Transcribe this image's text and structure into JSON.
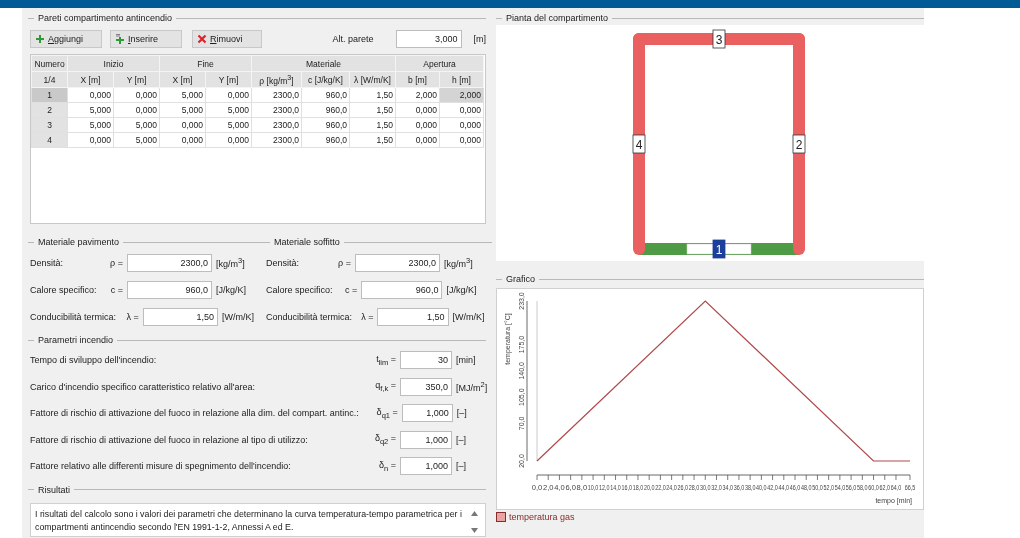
{
  "walls_section": {
    "title": "Pareti compartimento antincendio",
    "buttons": [
      {
        "label": "Aggiungi",
        "kind": "add"
      },
      {
        "label": "Inserire",
        "kind": "insert"
      },
      {
        "label": "Rimuovi",
        "kind": "remove"
      }
    ],
    "height_field": {
      "label": "Alt. parete",
      "value": "3,000",
      "unit": "[m]"
    }
  },
  "table": {
    "group_headers": [
      "Numero",
      "Inizio",
      "Fine",
      "Materiale",
      "Apertura"
    ],
    "columns": [
      "1/4",
      "X [m]",
      "Y [m]",
      "X [m]",
      "Y [m]",
      "ρ [kg/m$^{3}$]",
      "c [J/kg/K]",
      "λ [W/m/K]",
      "b [m]",
      "h [m]"
    ],
    "rows": [
      {
        "selected": true,
        "cells": [
          "1",
          "0,000",
          "0,000",
          "5,000",
          "0,000",
          "2300,0",
          "960,0",
          "1,50",
          "2,000",
          "2,000"
        ]
      },
      {
        "selected": false,
        "cells": [
          "2",
          "5,000",
          "0,000",
          "5,000",
          "5,000",
          "2300,0",
          "960,0",
          "1,50",
          "0,000",
          "0,000"
        ]
      },
      {
        "selected": false,
        "cells": [
          "3",
          "5,000",
          "5,000",
          "0,000",
          "5,000",
          "2300,0",
          "960,0",
          "1,50",
          "0,000",
          "0,000"
        ]
      },
      {
        "selected": false,
        "cells": [
          "4",
          "0,000",
          "5,000",
          "0,000",
          "0,000",
          "2300,0",
          "960,0",
          "1,50",
          "0,000",
          "0,000"
        ]
      }
    ]
  },
  "floor_material": {
    "title": "Materiale pavimento",
    "fields": [
      {
        "label": "Densità:",
        "symbol": "ρ =",
        "value": "2300,0",
        "unit": "[kg/m$^{3}$]"
      },
      {
        "label": "Calore specifico:",
        "symbol": "c =",
        "value": "960,0",
        "unit": "[J/kg/K]"
      },
      {
        "label": "Conducibilità termica:",
        "symbol": "λ =",
        "value": "1,50",
        "unit": "[W/m/K]"
      }
    ]
  },
  "ceiling_material": {
    "title": "Materiale soffitto",
    "fields": [
      {
        "label": "Densità:",
        "symbol": "ρ =",
        "value": "2300,0",
        "unit": "[kg/m$^{3}$]"
      },
      {
        "label": "Calore specifico:",
        "symbol": "c =",
        "value": "960,0",
        "unit": "[J/kg/K]"
      },
      {
        "label": "Conducibilità termica:",
        "symbol": "λ =",
        "value": "1,50",
        "unit": "[W/m/K]"
      }
    ]
  },
  "fire_parameters": {
    "title": "Parametri incendio",
    "fields": [
      {
        "label": "Tempo di sviluppo dell'incendio:",
        "symbol": "t$_{lim}$ =",
        "value": "30",
        "unit": "[min]"
      },
      {
        "label": "Carico d'incendio specifico caratteristico relativo all'area:",
        "symbol": "q$_{f,k}$ =",
        "value": "350,0",
        "unit": "[MJ/m$^{2}$]"
      },
      {
        "label": "Fattore di rischio di attivazione del fuoco in relazione alla dim. del compart. antinc.:",
        "symbol": "δ$_{q1}$ =",
        "value": "1,000",
        "unit": "[–]"
      },
      {
        "label": "Fattore di rischio di attivazione del fuoco in relazione al tipo di utilizzo:",
        "symbol": "δ$_{q2}$ =",
        "value": "1,000",
        "unit": "[–]"
      },
      {
        "label": "Fattore relativo alle differenti misure di spegnimento dell'incendio:",
        "symbol": "δ$_{n}$ =",
        "value": "1,000",
        "unit": "[–]"
      }
    ]
  },
  "results": {
    "title": "Risultati",
    "text": "I risultati del calcolo sono i valori dei parametri che determinano la curva temperatura-tempo parametrica per i compartmenti antincendio secondo l'EN 1991-1-2, Annessi A ed E."
  },
  "plan": {
    "title": "Pianta del compartimento",
    "walls": [
      {
        "label": "1",
        "selected": true
      },
      {
        "label": "2",
        "selected": false
      },
      {
        "label": "3",
        "selected": false
      },
      {
        "label": "4",
        "selected": false
      }
    ]
  },
  "chart_panel": {
    "title": "Grafico",
    "chart_data": {
      "type": "line",
      "xlabel": "tempo [min]",
      "ylabel": "temperatura [°C]",
      "x": [
        0,
        30,
        60,
        66.5
      ],
      "series": [
        {
          "name": "temperatura gas",
          "color": "#b04848",
          "values": [
            20,
            233,
            20,
            20
          ]
        }
      ],
      "xlim": [
        0,
        66.5
      ],
      "ylim": [
        20,
        233
      ],
      "xticks": [
        {
          "value": 0,
          "label": "0,0"
        },
        {
          "value": 2,
          "label": "2,0"
        },
        {
          "value": 4,
          "label": "4,0"
        },
        {
          "value": 6,
          "label": "6,0"
        },
        {
          "value": 8,
          "label": "8,0"
        },
        {
          "value": 10,
          "label": "10,0"
        },
        {
          "value": 12,
          "label": "12,0"
        },
        {
          "value": 14,
          "label": "14,0"
        },
        {
          "value": 16,
          "label": "16,0"
        },
        {
          "value": 18,
          "label": "18,0"
        },
        {
          "value": 20,
          "label": "20,0"
        },
        {
          "value": 22,
          "label": "22,0"
        },
        {
          "value": 24,
          "label": "24,0"
        },
        {
          "value": 26,
          "label": "26,0"
        },
        {
          "value": 28,
          "label": "28,0"
        },
        {
          "value": 30,
          "label": "30,0"
        },
        {
          "value": 32,
          "label": "32,0"
        },
        {
          "value": 34,
          "label": "34,0"
        },
        {
          "value": 36,
          "label": "36,0"
        },
        {
          "value": 38,
          "label": "38,0"
        },
        {
          "value": 40,
          "label": "40,0"
        },
        {
          "value": 42,
          "label": "42,0"
        },
        {
          "value": 44,
          "label": "44,0"
        },
        {
          "value": 46,
          "label": "46,0"
        },
        {
          "value": 48,
          "label": "48,0"
        },
        {
          "value": 50,
          "label": "50,0"
        },
        {
          "value": 52,
          "label": "52,0"
        },
        {
          "value": 54,
          "label": "54,0"
        },
        {
          "value": 56,
          "label": "56,0"
        },
        {
          "value": 58,
          "label": "58,0"
        },
        {
          "value": 60,
          "label": "60,0"
        },
        {
          "value": 62,
          "label": "62,0"
        },
        {
          "value": 64,
          "label": "64,0"
        },
        {
          "value": 66.5,
          "label": "66,5"
        }
      ],
      "yticks": [
        {
          "value": 20,
          "label": "20,0"
        },
        {
          "value": 70,
          "label": "70,0"
        },
        {
          "value": 105,
          "label": "105,0"
        },
        {
          "value": 140,
          "label": "140,0"
        },
        {
          "value": 175,
          "label": "175,0"
        },
        {
          "value": 233,
          "label": "233,0"
        }
      ]
    },
    "legend": {
      "color": "#e8a3a3"
    }
  }
}
